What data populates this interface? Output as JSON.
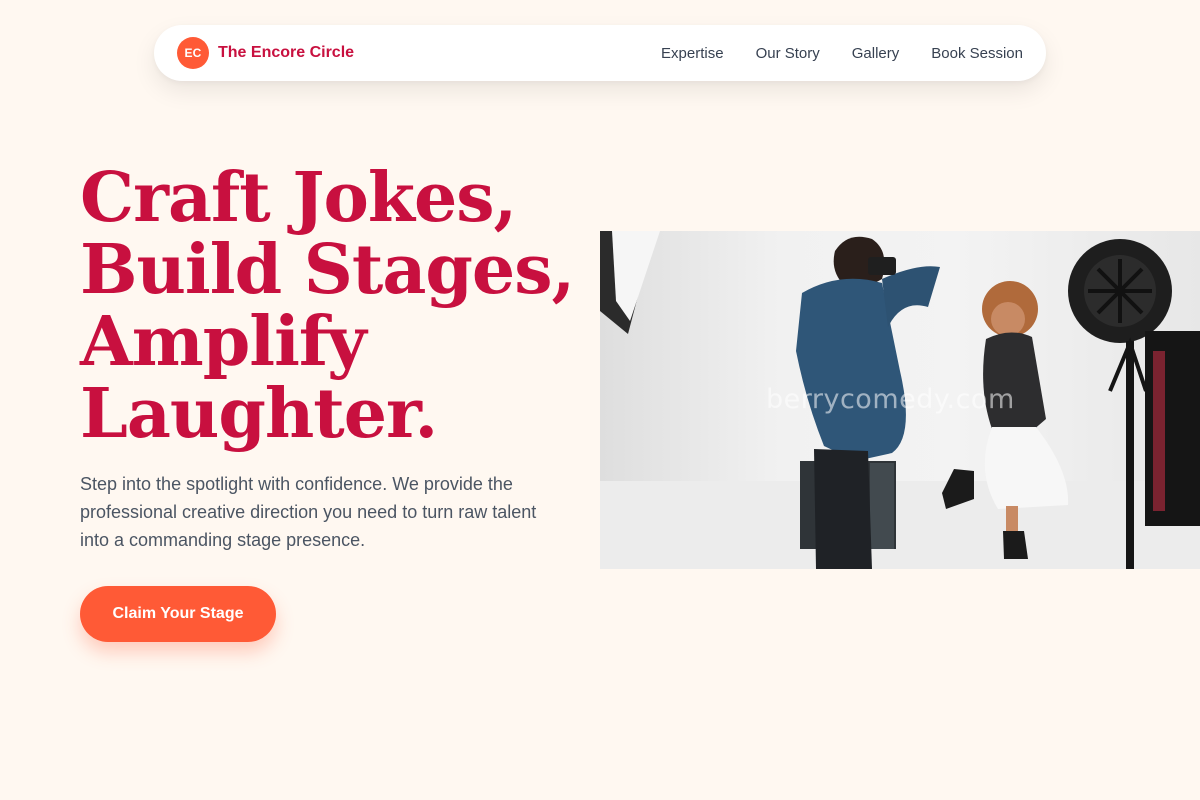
{
  "brand": {
    "logo_text": "EC",
    "name": "The Encore Circle"
  },
  "nav": {
    "links": [
      "Expertise",
      "Our Story",
      "Gallery",
      "Book Session"
    ]
  },
  "hero": {
    "title_lines": [
      "Craft Jokes,",
      "Build Stages,",
      "Amplify",
      "Laughter."
    ],
    "description": "Step into the spotlight with confidence. We provide the professional creative direction you need to turn raw talent into a commanding stage presence.",
    "cta_label": "Claim Your Stage"
  },
  "photo": {
    "watermark": "berrycomedy.com"
  },
  "colors": {
    "accent": "#ff5a36",
    "brand": "#c8103f",
    "background": "#fff8f1"
  }
}
